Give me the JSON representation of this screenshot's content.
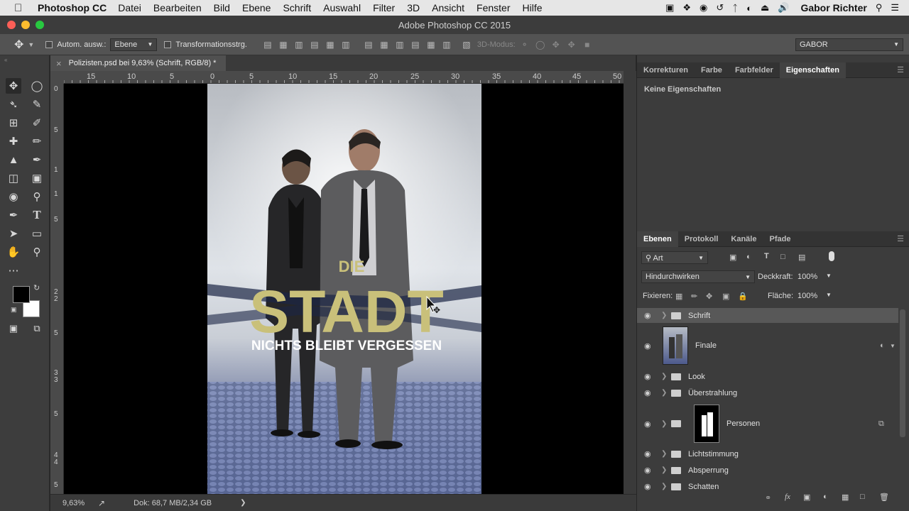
{
  "menubar": {
    "app_name": "Photoshop CC",
    "items": [
      "Datei",
      "Bearbeiten",
      "Bild",
      "Ebene",
      "Schrift",
      "Auswahl",
      "Filter",
      "3D",
      "Ansicht",
      "Fenster",
      "Hilfe"
    ],
    "user": "Gabor Richter"
  },
  "window": {
    "title": "Adobe Photoshop CC 2015"
  },
  "options_bar": {
    "auto_select_label": "Autom. ausw.:",
    "auto_select_value": "Ebene",
    "transform_label": "Transformationsstrg.",
    "mode_3d": "3D-Modus:",
    "workspace": "GABOR"
  },
  "document": {
    "tab_title": "Polizisten.psd bei 9,63% (Schrift, RGB/8) *",
    "ruler_top": [
      "15",
      "10",
      "5",
      "0",
      "5",
      "10",
      "15",
      "20",
      "25",
      "30",
      "35",
      "40",
      "45",
      "50"
    ],
    "ruler_left": [
      "0",
      "5",
      "1",
      "1",
      "5",
      "2",
      "2",
      "5",
      "3",
      "3",
      "5",
      "4",
      "4",
      "5",
      "5"
    ],
    "poster": {
      "line1": "DIE",
      "line2": "STADT",
      "line3": "NICHTS BLEIBT VERGESSEN"
    }
  },
  "status": {
    "zoom": "9,63%",
    "doc": "Dok: 68,7 MB/2,34 GB"
  },
  "properties_panel": {
    "tabs": [
      "Korrekturen",
      "Farbe",
      "Farbfelder",
      "Eigenschaften"
    ],
    "active_tab": "Eigenschaften",
    "empty_text": "Keine Eigenschaften"
  },
  "layers_panel": {
    "tabs": [
      "Ebenen",
      "Protokoll",
      "Kanäle",
      "Pfade"
    ],
    "active_tab": "Ebenen",
    "filter_label": "Art",
    "blend_mode": "Hindurchwirken",
    "opacity_label": "Deckkraft:",
    "opacity_value": "100%",
    "lock_label": "Fixieren:",
    "fill_label": "Fläche:",
    "fill_value": "100%",
    "layers": [
      {
        "name": "Schrift"
      },
      {
        "name": "Finale"
      },
      {
        "name": "Look"
      },
      {
        "name": "Überstrahlung"
      },
      {
        "name": "Personen"
      },
      {
        "name": "Lichtstimmung"
      },
      {
        "name": "Absperrung"
      },
      {
        "name": "Schatten"
      }
    ]
  },
  "colors": {
    "title_gold": "#c9c07a",
    "selected_layer": "#585858",
    "panel_bg": "#3c3c3c"
  }
}
